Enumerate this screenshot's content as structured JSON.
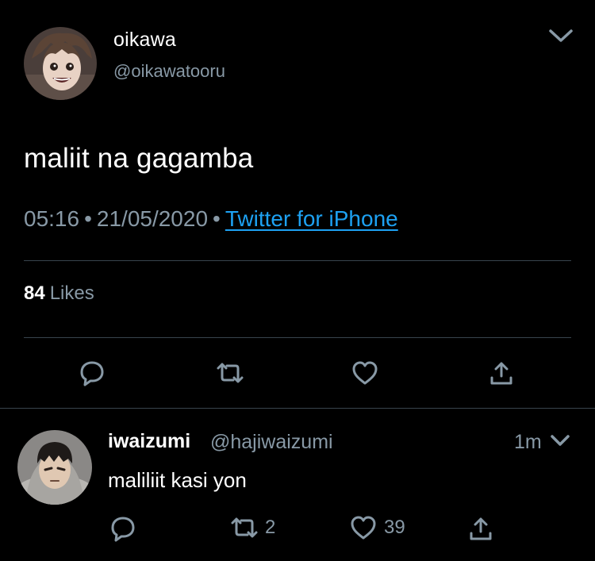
{
  "colors": {
    "background": "#000000",
    "text": "#ffffff",
    "secondary": "#8899a6",
    "link": "#1da1f2",
    "divider": "#38444d"
  },
  "tweet": {
    "author": {
      "name": "oikawa",
      "handle": "@oikawatooru",
      "avatar": "anime-character-avatar"
    },
    "text": "maliit na gagamba",
    "time": "05:16",
    "separator": "•",
    "date": "21/05/2020",
    "source": "Twitter for iPhone",
    "likes_count": "84",
    "likes_label": "Likes",
    "menu_icon": "chevron-down-icon",
    "actions": [
      {
        "name": "reply",
        "icon": "comment-icon"
      },
      {
        "name": "retweet",
        "icon": "retweet-icon"
      },
      {
        "name": "like",
        "icon": "heart-icon"
      },
      {
        "name": "share",
        "icon": "share-icon"
      }
    ]
  },
  "reply": {
    "author": {
      "name": "iwaizumi",
      "handle": "@hajiwaizumi",
      "avatar": "anime-character-avatar"
    },
    "time": "1m",
    "text": "maliliit kasi yon",
    "retweet_count": "2",
    "like_count": "39",
    "menu_icon": "chevron-down-icon"
  }
}
